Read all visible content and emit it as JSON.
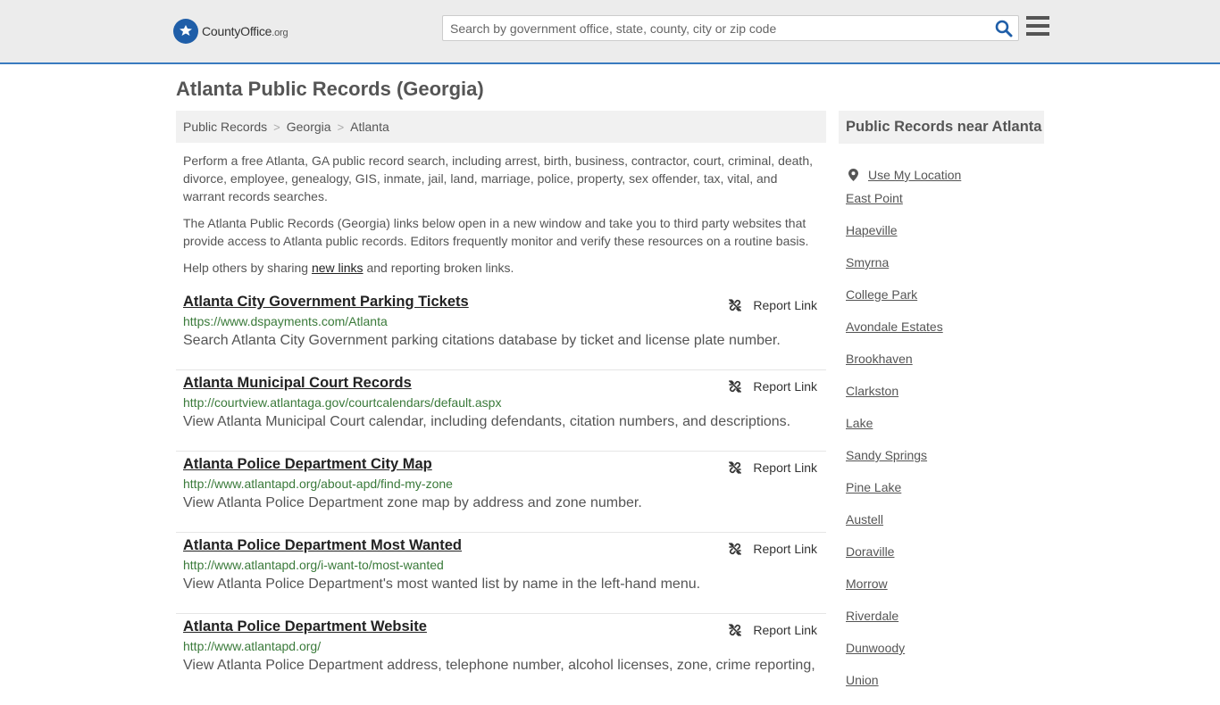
{
  "header": {
    "logo_name": "CountyOffice",
    "logo_suffix": ".org",
    "search_placeholder": "Search by government office, state, county, city or zip code"
  },
  "page_title": "Atlanta Public Records (Georgia)",
  "breadcrumb": [
    "Public Records",
    "Georgia",
    "Atlanta"
  ],
  "intro": {
    "p1": "Perform a free Atlanta, GA public record search, including arrest, birth, business, contractor, court, criminal, death, divorce, employee, genealogy, GIS, inmate, jail, land, marriage, police, property, sex offender, tax, vital, and warrant records searches.",
    "p2": "The Atlanta Public Records (Georgia) links below open in a new window and take you to third party websites that provide access to Atlanta public records. Editors frequently monitor and verify these resources on a routine basis.",
    "p3_before": "Help others by sharing ",
    "p3_link": "new links",
    "p3_after": " and reporting broken links."
  },
  "report_label": "Report Link",
  "records": [
    {
      "title": "Atlanta City Government Parking Tickets",
      "url": "https://www.dspayments.com/Atlanta",
      "desc": "Search Atlanta City Government parking citations database by ticket and license plate number."
    },
    {
      "title": "Atlanta Municipal Court Records",
      "url": "http://courtview.atlantaga.gov/courtcalendars/default.aspx",
      "desc": "View Atlanta Municipal Court calendar, including defendants, citation numbers, and descriptions."
    },
    {
      "title": "Atlanta Police Department City Map",
      "url": "http://www.atlantapd.org/about-apd/find-my-zone",
      "desc": "View Atlanta Police Department zone map by address and zone number."
    },
    {
      "title": "Atlanta Police Department Most Wanted",
      "url": "http://www.atlantapd.org/i-want-to/most-wanted",
      "desc": "View Atlanta Police Department's most wanted list by name in the left-hand menu."
    },
    {
      "title": "Atlanta Police Department Website",
      "url": "http://www.atlantapd.org/",
      "desc": "View Atlanta Police Department address, telephone number, alcohol licenses, zone, crime reporting,"
    }
  ],
  "sidebar": {
    "title": "Public Records near Atlanta",
    "use_location": "Use My Location",
    "cities": [
      "East Point",
      "Hapeville",
      "Smyrna",
      "College Park",
      "Avondale Estates",
      "Brookhaven",
      "Clarkston",
      "Lake",
      "Sandy Springs",
      "Pine Lake",
      "Austell",
      "Doraville",
      "Morrow",
      "Riverdale",
      "Dunwoody",
      "Union"
    ]
  }
}
